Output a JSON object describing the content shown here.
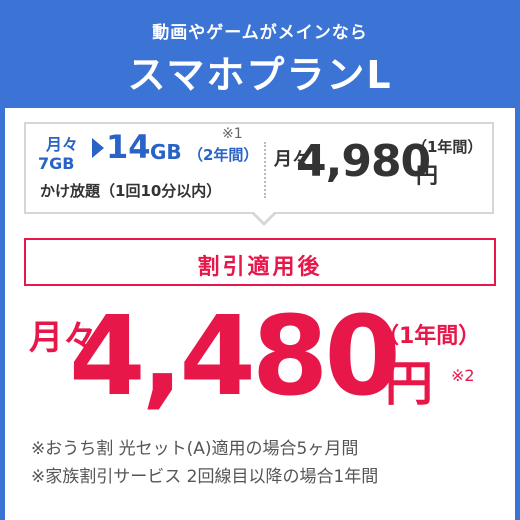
{
  "header": {
    "subtitle": "動画やゲームがメインなら",
    "title": "スマホプランL"
  },
  "info": {
    "month_prefix": "月々",
    "from_data": "7GB",
    "to_number": "14",
    "to_unit": "GB",
    "to_duration": "（2年間）",
    "note_mark": "※1",
    "unlimited_text": "かけ放題（1回10分以内）",
    "price_prefix": "月々",
    "price": "4,980",
    "price_duration": "（1年間）",
    "price_unit": "円"
  },
  "after_label": "割引適用後",
  "final": {
    "month_prefix": "月々",
    "price": "4,480",
    "duration": "（1年間）",
    "unit": "円",
    "note_mark": "※2"
  },
  "footnotes": [
    "※おうち割 光セット(A)適用の場合5ヶ月間",
    "※家族割引サービス 2回線目以降の場合1年間"
  ],
  "colors": {
    "header_blue": "#3c74d6",
    "accent_red": "#e8174a",
    "data_blue": "#2a63c7"
  }
}
